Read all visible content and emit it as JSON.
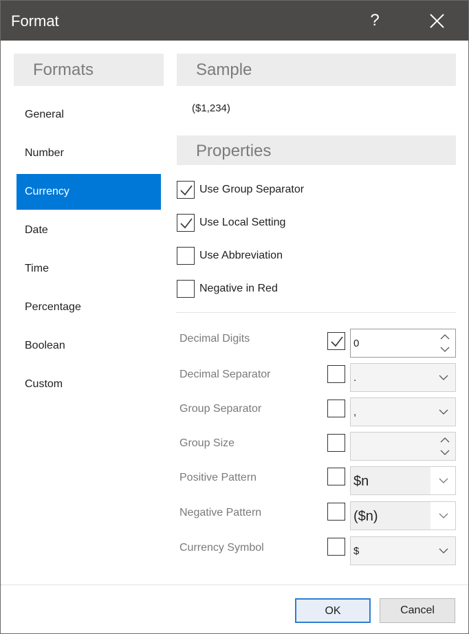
{
  "dialog": {
    "title": "Format",
    "help_label": "?"
  },
  "formats": {
    "header": "Formats",
    "items": [
      "General",
      "Number",
      "Currency",
      "Date",
      "Time",
      "Percentage",
      "Boolean",
      "Custom"
    ],
    "selected": "Currency"
  },
  "sample": {
    "header": "Sample",
    "value": "($1,234)"
  },
  "properties": {
    "header": "Properties",
    "options": [
      {
        "label": "Use Group Separator",
        "checked": true
      },
      {
        "label": "Use Local Setting",
        "checked": true
      },
      {
        "label": "Use Abbreviation",
        "checked": false
      },
      {
        "label": "Negative in Red",
        "checked": false
      }
    ],
    "fields": [
      {
        "label": "Decimal Digits",
        "checked": true,
        "value": "0",
        "control": "spinner"
      },
      {
        "label": "Decimal Separator",
        "checked": false,
        "value": ".",
        "control": "dropdown"
      },
      {
        "label": "Group Separator",
        "checked": false,
        "value": ",",
        "control": "dropdown"
      },
      {
        "label": "Group Size",
        "checked": false,
        "value": "",
        "control": "spinner"
      },
      {
        "label": "Positive Pattern",
        "checked": false,
        "value": "$n",
        "control": "combo"
      },
      {
        "label": "Negative Pattern",
        "checked": false,
        "value": "($n)",
        "control": "combo"
      },
      {
        "label": "Currency Symbol",
        "checked": false,
        "value": "$",
        "control": "dropdown"
      }
    ]
  },
  "buttons": {
    "ok": "OK",
    "cancel": "Cancel"
  },
  "colors": {
    "titlebar": "#4c4a48",
    "selection": "#0078d7",
    "header_bg": "#ececec",
    "label_gray": "#7a7a7a"
  }
}
